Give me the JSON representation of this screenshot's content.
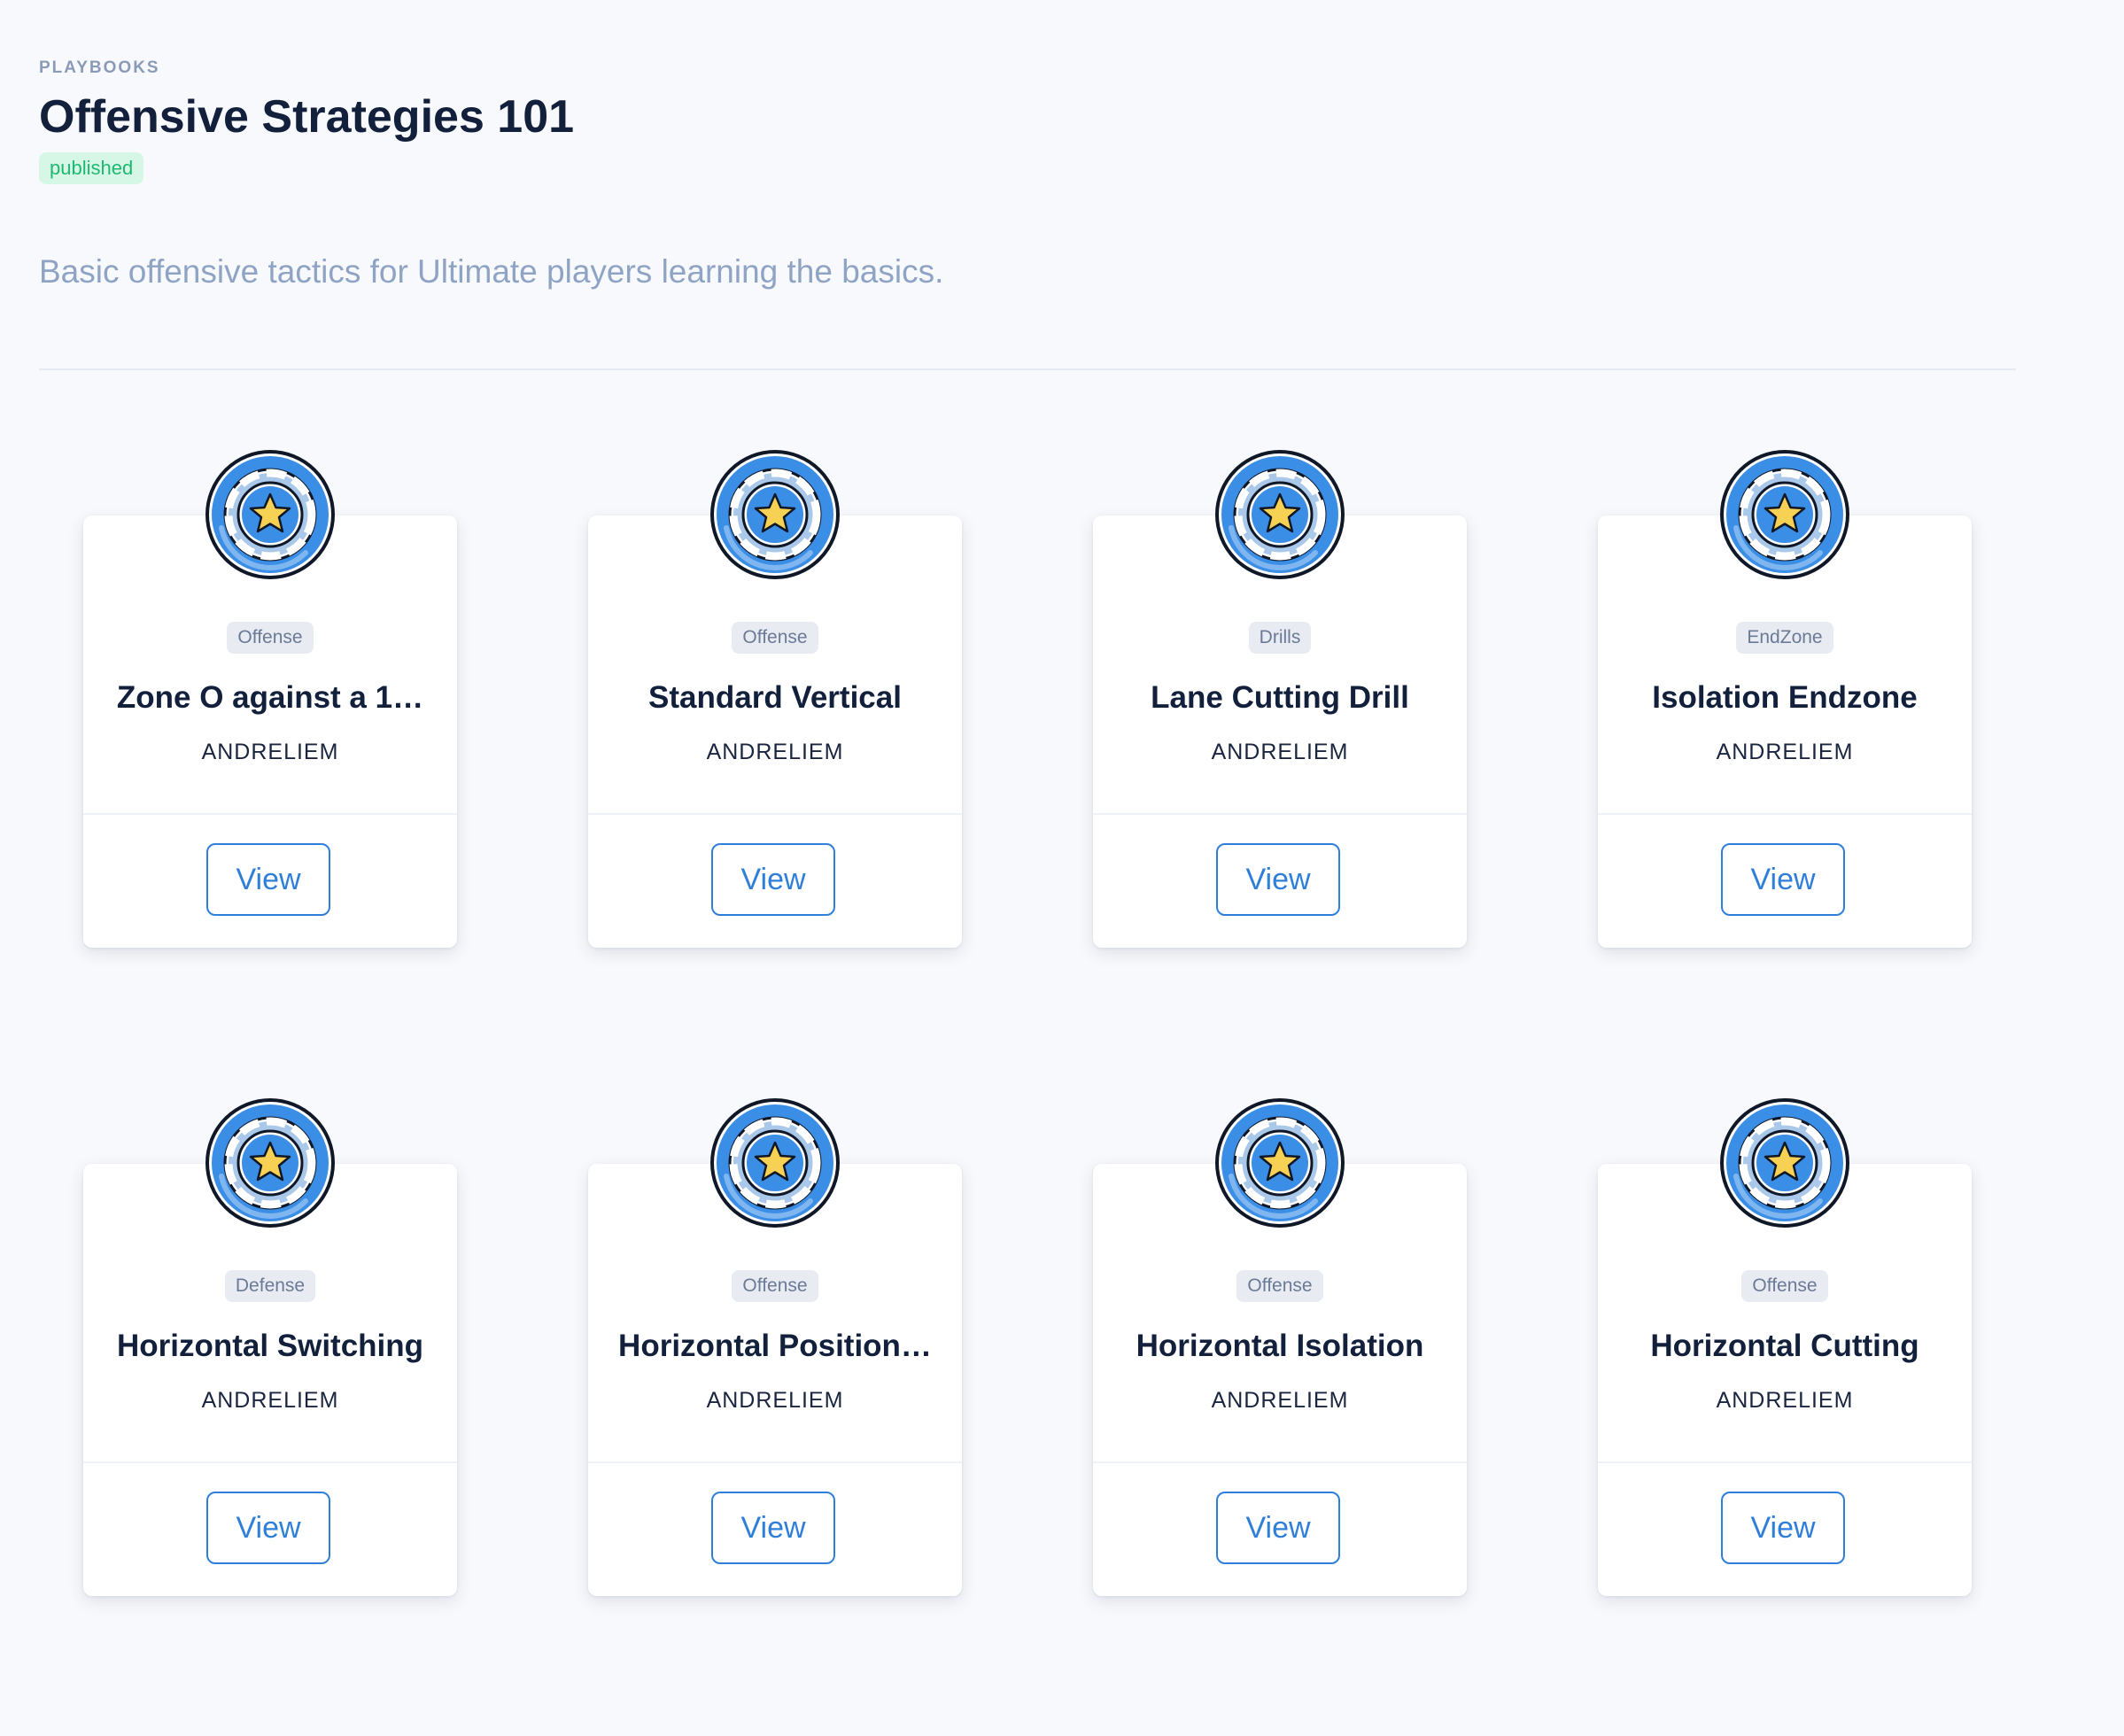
{
  "header": {
    "eyebrow": "PLAYBOOKS",
    "title": "Offensive Strategies 101",
    "status": "published",
    "description": "Basic offensive tactics for Ultimate players learning the basics."
  },
  "colors": {
    "accent": "#2f7fd9",
    "published_bg": "#d6f7e6",
    "published_text": "#1fb873",
    "medal_blue": "#3a8ee6",
    "medal_star": "#f7d154"
  },
  "cards": [
    {
      "tag": "Offense",
      "title": "Zone O against a 1…",
      "author": "ANDRELIEM",
      "button": "View",
      "icon": "medal-star-icon"
    },
    {
      "tag": "Offense",
      "title": "Standard Vertical",
      "author": "ANDRELIEM",
      "button": "View",
      "icon": "medal-star-icon"
    },
    {
      "tag": "Drills",
      "title": "Lane Cutting Drill",
      "author": "ANDRELIEM",
      "button": "View",
      "icon": "medal-star-icon"
    },
    {
      "tag": "EndZone",
      "title": "Isolation Endzone",
      "author": "ANDRELIEM",
      "button": "View",
      "icon": "medal-star-icon"
    },
    {
      "tag": "Defense",
      "title": "Horizontal Switching",
      "author": "ANDRELIEM",
      "button": "View",
      "icon": "medal-star-icon"
    },
    {
      "tag": "Offense",
      "title": "Horizontal Position…",
      "author": "ANDRELIEM",
      "button": "View",
      "icon": "medal-star-icon"
    },
    {
      "tag": "Offense",
      "title": "Horizontal Isolation",
      "author": "ANDRELIEM",
      "button": "View",
      "icon": "medal-star-icon"
    },
    {
      "tag": "Offense",
      "title": "Horizontal Cutting",
      "author": "ANDRELIEM",
      "button": "View",
      "icon": "medal-star-icon"
    }
  ]
}
